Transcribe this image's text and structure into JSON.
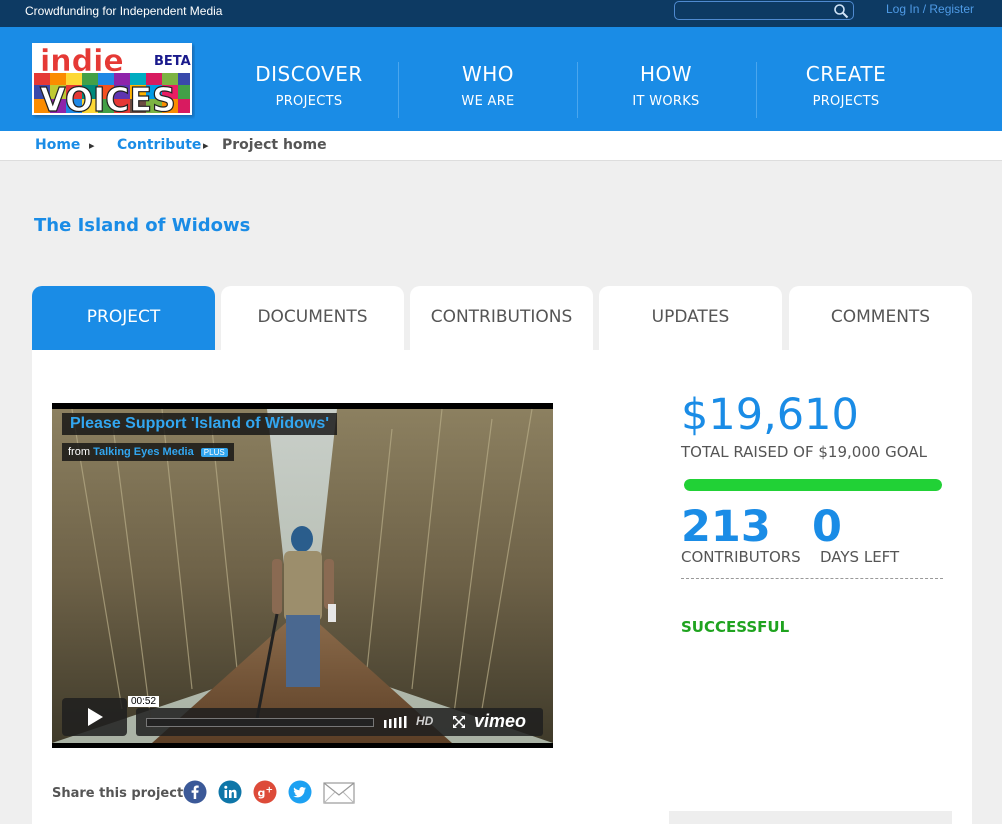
{
  "topbar": {
    "tagline": "Crowdfunding for Independent Media",
    "search_placeholder": "",
    "login_label": "Log In / Register"
  },
  "logo": {
    "word_top": "indie",
    "word_bottom": "VOICES",
    "badge": "BETA"
  },
  "nav": [
    {
      "big": "DISCOVER",
      "small": "PROJECTS"
    },
    {
      "big": "WHO",
      "small": "WE ARE"
    },
    {
      "big": "HOW",
      "small": "IT WORKS"
    },
    {
      "big": "CREATE",
      "small": "PROJECTS"
    }
  ],
  "breadcrumb": [
    "Home",
    "Contribute",
    "Project home"
  ],
  "project": {
    "title": "The Island of Widows"
  },
  "tabs": [
    "PROJECT",
    "DOCUMENTS",
    "CONTRIBUTIONS",
    "UPDATES",
    "COMMENTS"
  ],
  "video": {
    "title": "Please Support 'Island of Widows'",
    "from_label": "from",
    "from_name": "Talking Eyes Media",
    "plus_badge": "PLUS",
    "time": "00:52",
    "hd_label": "HD",
    "brand": "vimeo"
  },
  "share": {
    "label": "Share this project:",
    "icons": [
      "facebook-icon",
      "linkedin-icon",
      "google-plus-icon",
      "twitter-icon",
      "email-icon"
    ]
  },
  "stats": {
    "raised": "$19,610",
    "raised_label": "TOTAL RAISED OF $19,000 GOAL",
    "progress_percent": 100,
    "contributors": "213",
    "contributors_label": "CONTRIBUTORS",
    "days_left": "0",
    "days_left_label": "DAYS LEFT",
    "status": "SUCCESSFUL"
  },
  "colors": {
    "brand_blue": "#1a8ce6",
    "top_bar": "#0d3a63",
    "progress_green": "#21d136",
    "success_green": "#1fa31f"
  }
}
